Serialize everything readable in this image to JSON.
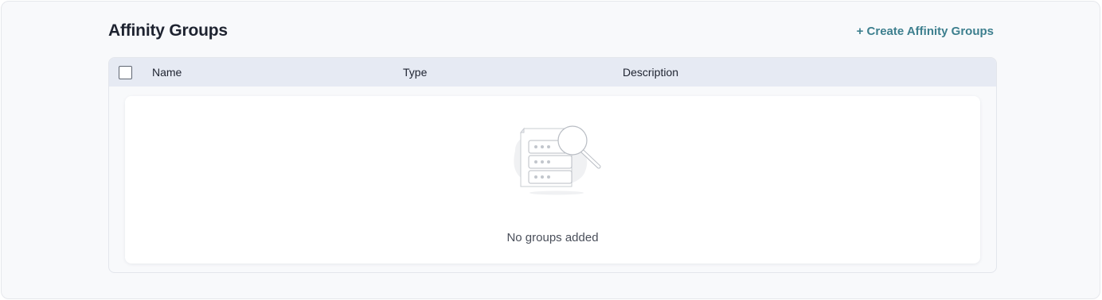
{
  "section": {
    "title": "Affinity Groups",
    "create_label": "+ Create Affinity Groups"
  },
  "table": {
    "columns": [
      "Name",
      "Type",
      "Description"
    ],
    "empty_message": "No groups added"
  },
  "icons": {
    "empty_state": "empty-search-servers-icon"
  },
  "colors": {
    "accent": "#3d7f8e",
    "header_bg": "#e6eaf3",
    "panel_bg": "#f8f9fb"
  }
}
